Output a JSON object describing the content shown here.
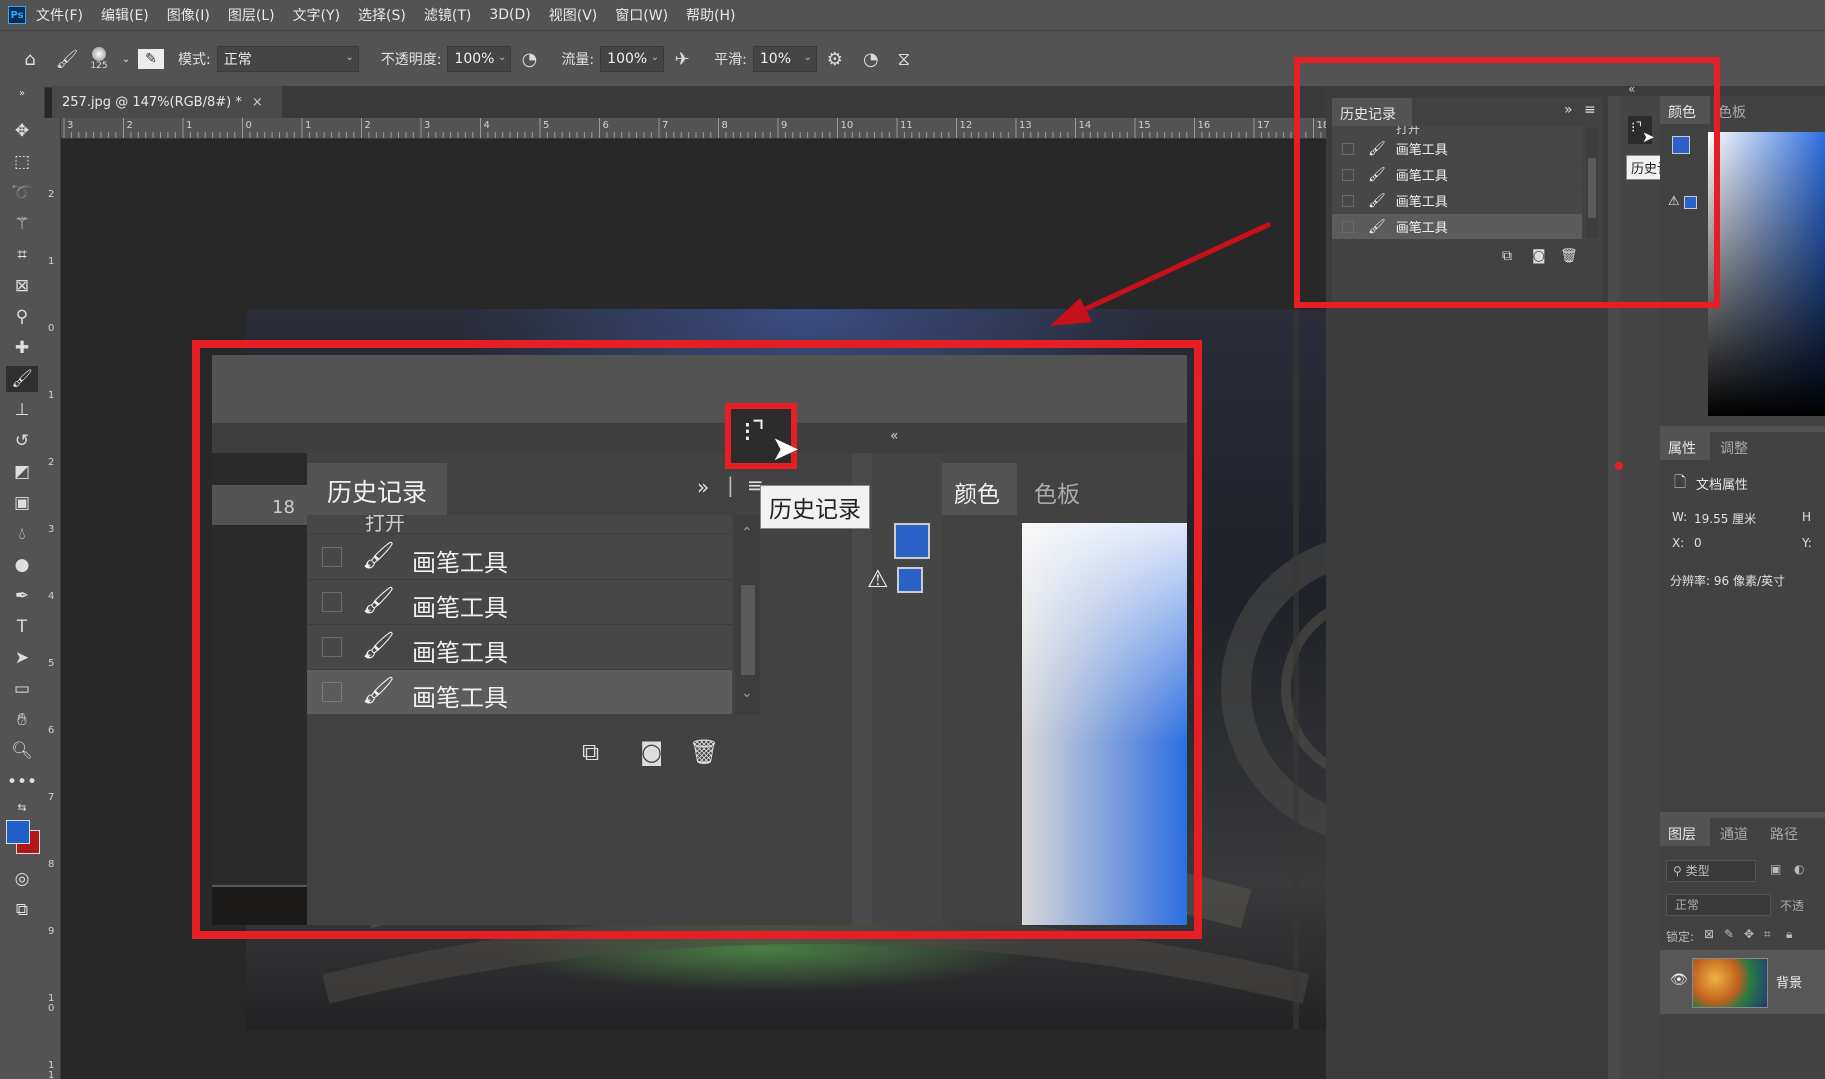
{
  "menu": [
    "文件(F)",
    "编辑(E)",
    "图像(I)",
    "图层(L)",
    "文字(Y)",
    "选择(S)",
    "滤镜(T)",
    "3D(D)",
    "视图(V)",
    "窗口(W)",
    "帮助(H)"
  ],
  "options_bar": {
    "brush_size": "125",
    "mode_label": "模式:",
    "mode_value": "正常",
    "opacity_label": "不透明度:",
    "opacity_value": "100%",
    "flow_label": "流量:",
    "flow_value": "100%",
    "smoothing_label": "平滑:",
    "smoothing_value": "10%"
  },
  "document_tab": {
    "title": "257.jpg @ 147%(RGB/8#) *",
    "close": "×"
  },
  "ruler_h": [
    "3",
    "2",
    "1",
    "0",
    "1",
    "2",
    "3",
    "4",
    "5",
    "6",
    "7",
    "8",
    "9",
    "10",
    "11",
    "12",
    "13",
    "14",
    "15",
    "16",
    "17",
    "18"
  ],
  "ruler_v": [
    "2",
    "1",
    "0",
    "1",
    "2",
    "3",
    "4",
    "5",
    "6",
    "7",
    "8",
    "9",
    "1\n0",
    "1\n1"
  ],
  "history_panel": {
    "title": "历史记录",
    "collapsed_first": "打开",
    "items": [
      "画笔工具",
      "画笔工具",
      "画笔工具",
      "画笔工具"
    ]
  },
  "history_panel_small": {
    "ruler_tick": "18"
  },
  "tooltip": "历史记录",
  "color_panel": {
    "tab1": "颜色",
    "tab2": "色板"
  },
  "properties_panel": {
    "tab1": "属性",
    "tab2": "调整",
    "doc_props": "文档属性",
    "w_label": "W:",
    "w_value": "19.55 厘米",
    "h_label": "H",
    "x_label": "X:",
    "x_value": "0",
    "y_label": "Y:",
    "resolution": "分辨率: 96 像素/英寸"
  },
  "layers_panel": {
    "tab1": "图层",
    "tab2": "通道",
    "tab3": "路径",
    "filter_kind": "类型",
    "blend_mode": "正常",
    "opacity_short": "不透",
    "lock_label": "锁定:",
    "layer_name": "背景"
  },
  "colors": {
    "accent_red": "#e51f23",
    "fg_swatch": "#1e5fc8",
    "bg_swatch": "#b01818"
  }
}
